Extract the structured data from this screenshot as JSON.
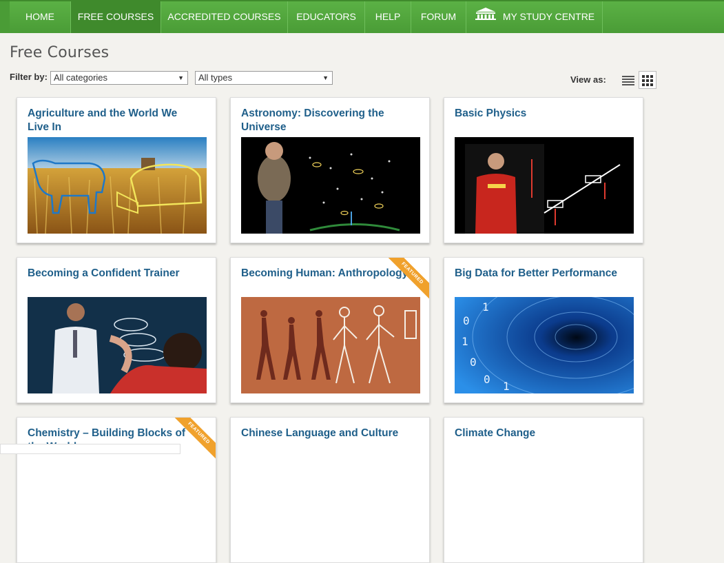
{
  "nav": {
    "items": [
      {
        "label": "HOME"
      },
      {
        "label": "FREE COURSES"
      },
      {
        "label": "ACCREDITED COURSES"
      },
      {
        "label": "EDUCATORS"
      },
      {
        "label": "HELP"
      },
      {
        "label": "FORUM"
      },
      {
        "label": "MY STUDY CENTRE",
        "icon": "building-icon"
      }
    ],
    "active": "FREE COURSES"
  },
  "page": {
    "title": "Free Courses"
  },
  "filter": {
    "label": "Filter by:",
    "category": "All categories",
    "type": "All types",
    "view_label": "View as:"
  },
  "courses": [
    {
      "title": "Agriculture and the World We Live In",
      "featured": false
    },
    {
      "title": "Astronomy: Discovering the Universe",
      "featured": false
    },
    {
      "title": "Basic Physics",
      "featured": false
    },
    {
      "title": "Becoming a Confident Trainer",
      "featured": false
    },
    {
      "title": "Becoming Human: Anthropology",
      "featured": true
    },
    {
      "title": "Big Data for Better Performance",
      "featured": false
    },
    {
      "title": "Chemistry – Building Blocks of the World",
      "featured": true
    },
    {
      "title": "Chinese Language and Culture",
      "featured": false
    },
    {
      "title": "Climate Change",
      "featured": false
    }
  ],
  "badge": {
    "featured": "FEATURED"
  },
  "colors": {
    "nav": "#4a9c36",
    "title": "#1f5f8a",
    "ribbon": "#f0a12c"
  }
}
